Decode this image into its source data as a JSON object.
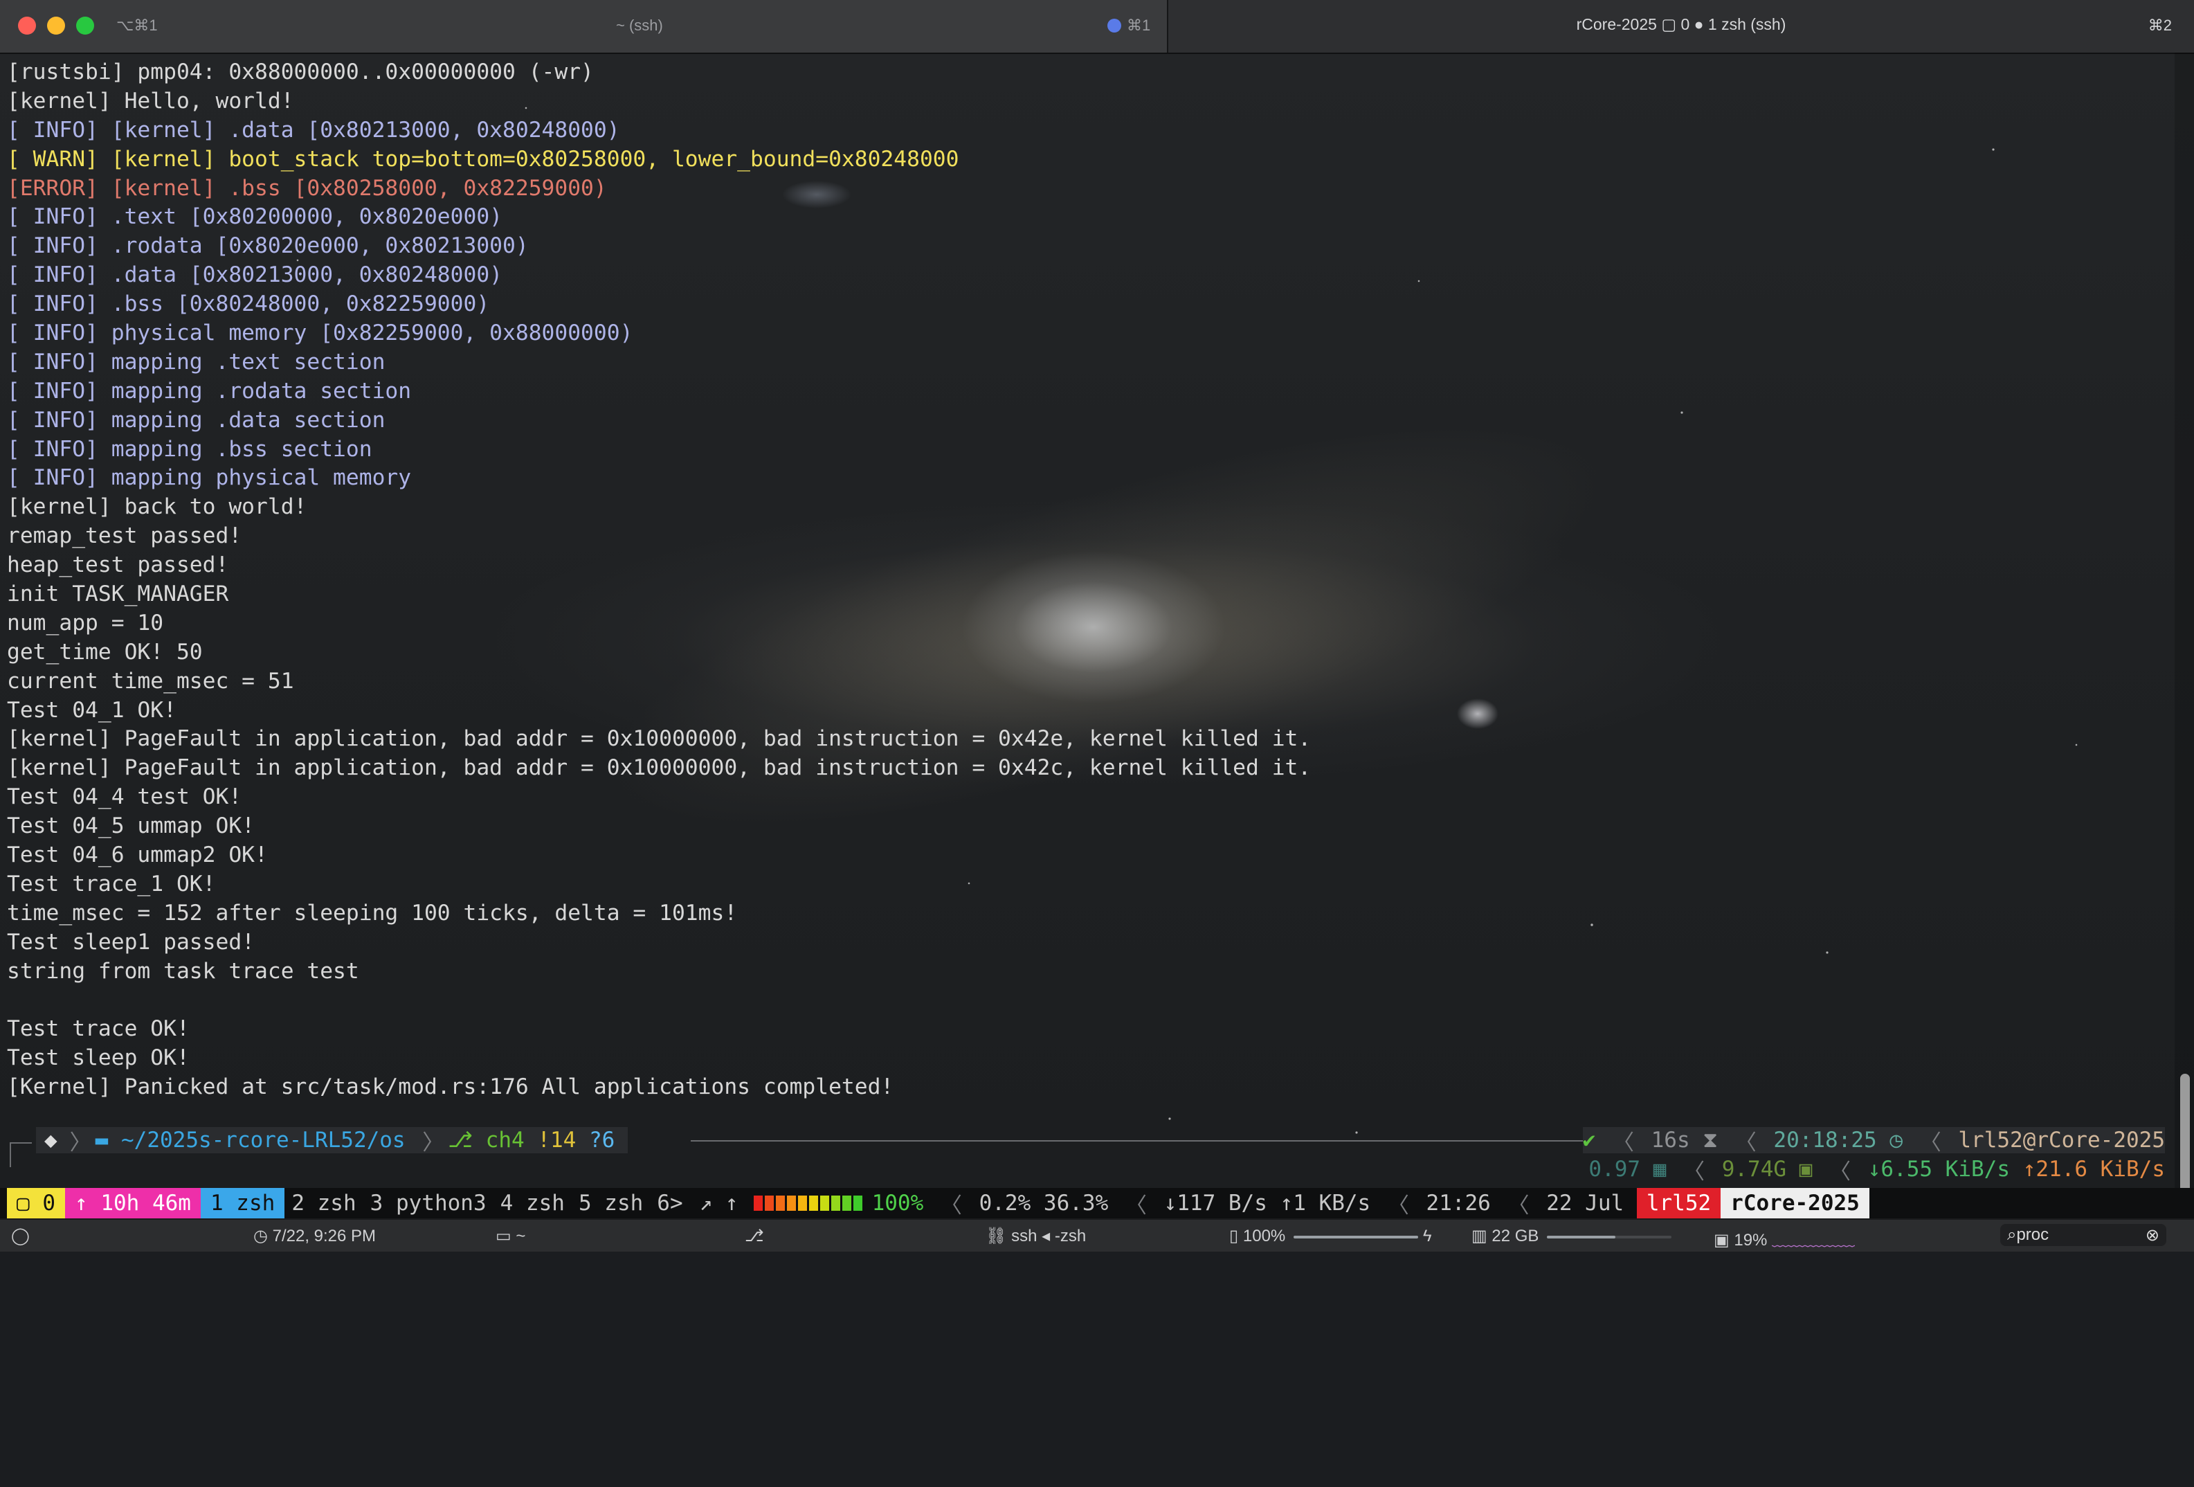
{
  "window": {
    "colors": {
      "close": "#ff5f57",
      "minimize": "#febc2e",
      "zoom": "#28c840"
    },
    "left_tab": {
      "shortcut": "⌥⌘1",
      "title": "~ (ssh)",
      "badge": "⌘1"
    },
    "right_tab": {
      "title": "rCore-2025 ▢ 0 ● 1 zsh (ssh)",
      "shortcut": "⌘2"
    }
  },
  "terminal": {
    "lines": [
      {
        "text": "[rustsbi] pmp04: 0x88000000..0x00000000 (-wr)",
        "level": "plain"
      },
      {
        "text": "[kernel] Hello, world!",
        "level": "plain"
      },
      {
        "text": "[ INFO] [kernel] .data [0x80213000, 0x80248000)",
        "level": "info"
      },
      {
        "text": "[ WARN] [kernel] boot_stack top=bottom=0x80258000, lower_bound=0x80248000",
        "level": "warn"
      },
      {
        "text": "[ERROR] [kernel] .bss [0x80258000, 0x82259000)",
        "level": "error"
      },
      {
        "text": "[ INFO] .text [0x80200000, 0x8020e000)",
        "level": "info"
      },
      {
        "text": "[ INFO] .rodata [0x8020e000, 0x80213000)",
        "level": "info"
      },
      {
        "text": "[ INFO] .data [0x80213000, 0x80248000)",
        "level": "info"
      },
      {
        "text": "[ INFO] .bss [0x80248000, 0x82259000)",
        "level": "info"
      },
      {
        "text": "[ INFO] physical memory [0x82259000, 0x88000000)",
        "level": "info"
      },
      {
        "text": "[ INFO] mapping .text section",
        "level": "info"
      },
      {
        "text": "[ INFO] mapping .rodata section",
        "level": "info"
      },
      {
        "text": "[ INFO] mapping .data section",
        "level": "info"
      },
      {
        "text": "[ INFO] mapping .bss section",
        "level": "info"
      },
      {
        "text": "[ INFO] mapping physical memory",
        "level": "info"
      },
      {
        "text": "[kernel] back to world!",
        "level": "plain"
      },
      {
        "text": "remap_test passed!",
        "level": "plain"
      },
      {
        "text": "heap_test passed!",
        "level": "plain"
      },
      {
        "text": "init TASK_MANAGER",
        "level": "plain"
      },
      {
        "text": "num_app = 10",
        "level": "plain"
      },
      {
        "text": "get_time OK! 50",
        "level": "plain"
      },
      {
        "text": "current time_msec = 51",
        "level": "plain"
      },
      {
        "text": "Test 04_1 OK!",
        "level": "plain"
      },
      {
        "text": "[kernel] PageFault in application, bad addr = 0x10000000, bad instruction = 0x42e, kernel killed it.",
        "level": "plain"
      },
      {
        "text": "[kernel] PageFault in application, bad addr = 0x10000000, bad instruction = 0x42c, kernel killed it.",
        "level": "plain"
      },
      {
        "text": "Test 04_4 test OK!",
        "level": "plain"
      },
      {
        "text": "Test 04_5 ummap OK!",
        "level": "plain"
      },
      {
        "text": "Test 04_6 ummap2 OK!",
        "level": "plain"
      },
      {
        "text": "Test trace_1 OK!",
        "level": "plain"
      },
      {
        "text": "time_msec = 152 after sleeping 100 ticks, delta = 101ms!",
        "level": "plain"
      },
      {
        "text": "Test sleep1 passed!",
        "level": "plain"
      },
      {
        "text": "string from task trace test",
        "level": "plain"
      },
      {
        "text": "",
        "level": "plain"
      },
      {
        "text": "Test trace OK!",
        "level": "plain"
      },
      {
        "text": "Test sleep OK!",
        "level": "plain"
      },
      {
        "text": "[Kernel] Panicked at src/task/mod.rs:176 All applications completed!",
        "level": "plain"
      }
    ]
  },
  "prompt": {
    "path": "~/2025s-rcore-LRL52/os",
    "git_branch": "ch4",
    "git_modified": "!14",
    "git_untracked": "?6",
    "status": "✔",
    "duration": "16s",
    "clock": "20:18:25",
    "user_host": "lrl52@rCore-2025",
    "load": "0.97",
    "mem": "9.74G",
    "net_down": "↓6.55 KiB/s",
    "net_up": "↑21.6 KiB/s"
  },
  "tmux": {
    "session": "0",
    "uptime": "↑ 10h 46m",
    "active_window": "1 zsh",
    "windows": [
      "2 zsh",
      "3 python3",
      "4 zsh",
      "5 zsh",
      "6>"
    ],
    "arrows": "↗ ↑",
    "battery_fraction": 1.0,
    "battery": "100%",
    "cpu": "0.2%",
    "mem": "36.3%",
    "net": "↓117 B/s ↑1 KB/s",
    "time": "21:26",
    "date": "22 Jul",
    "user": "lrl52",
    "host": "rCore-2025"
  },
  "menubar": {
    "datetime": "7/22, 9:26 PM",
    "folder": "~",
    "git": "",
    "session": "ssh ◂ -zsh",
    "battery": "100%",
    "battery_fraction": 1.0,
    "memory": "22 GB",
    "memory_fraction": 0.55,
    "cpu": "19%",
    "search": "proc"
  }
}
